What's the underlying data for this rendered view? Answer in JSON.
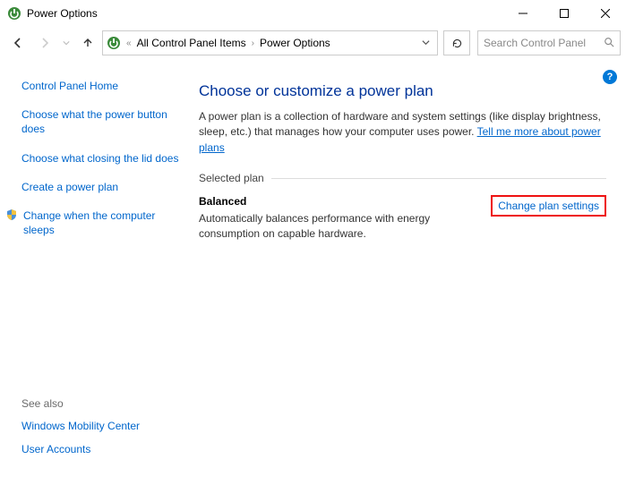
{
  "window": {
    "title": "Power Options"
  },
  "breadcrumb": {
    "item1": "All Control Panel Items",
    "item2": "Power Options"
  },
  "search": {
    "placeholder": "Search Control Panel"
  },
  "sidebar": {
    "home": "Control Panel Home",
    "l1": "Choose what the power button does",
    "l2": "Choose what closing the lid does",
    "l3": "Create a power plan",
    "l4": "Change when the computer sleeps"
  },
  "seealso": {
    "header": "See also",
    "l1": "Windows Mobility Center",
    "l2": "User Accounts"
  },
  "main": {
    "heading": "Choose or customize a power plan",
    "description_prefix": "A power plan is a collection of hardware and system settings (like display brightness, sleep, etc.) that manages how your computer uses power. ",
    "description_link": "Tell me more about power plans",
    "selected_plan_label": "Selected plan",
    "plan_name": "Balanced",
    "plan_desc": "Automatically balances performance with energy consumption on capable hardware.",
    "change_settings": "Change plan settings"
  },
  "help": {
    "q": "?"
  }
}
